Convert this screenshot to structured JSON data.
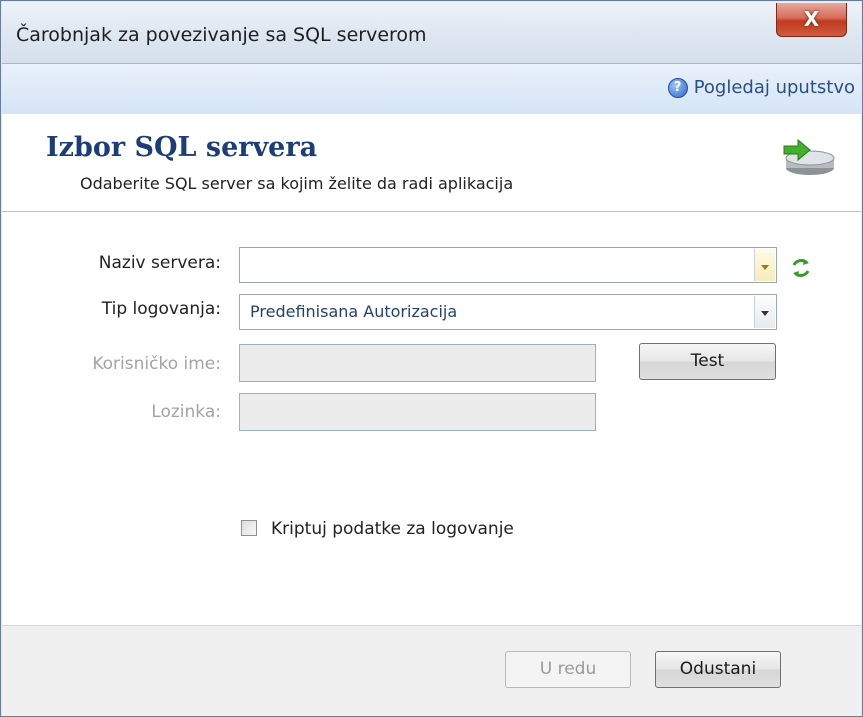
{
  "window": {
    "title": "Čarobnjak za povezivanje sa SQL serverom",
    "close_glyph": "X"
  },
  "help": {
    "label": "Pogledaj uputstvo",
    "icon": "help-icon"
  },
  "header": {
    "title": "Izbor SQL servera",
    "subtitle": "Odaberite SQL server sa kojim želite da radi aplikacija",
    "icon": "database-arrow-icon"
  },
  "form": {
    "server_label": "Naziv servera:",
    "server_value": "",
    "login_type_label": "Tip logovanja:",
    "login_type_value": "Predefinisana Autorizacija",
    "username_label": "Korisničko ime:",
    "username_value": "",
    "password_label": "Lozinka:",
    "password_value": "",
    "test_button": "Test",
    "encrypt_label": "Kriptuj podatke za logovanje",
    "encrypt_checked": false
  },
  "footer": {
    "ok_button": "U redu",
    "cancel_button": "Odustani"
  },
  "colors": {
    "header_title": "#1c3d78",
    "help_link": "#2a4f86",
    "close_button": "#c23a20",
    "refresh_icon": "#3a9a2a"
  }
}
